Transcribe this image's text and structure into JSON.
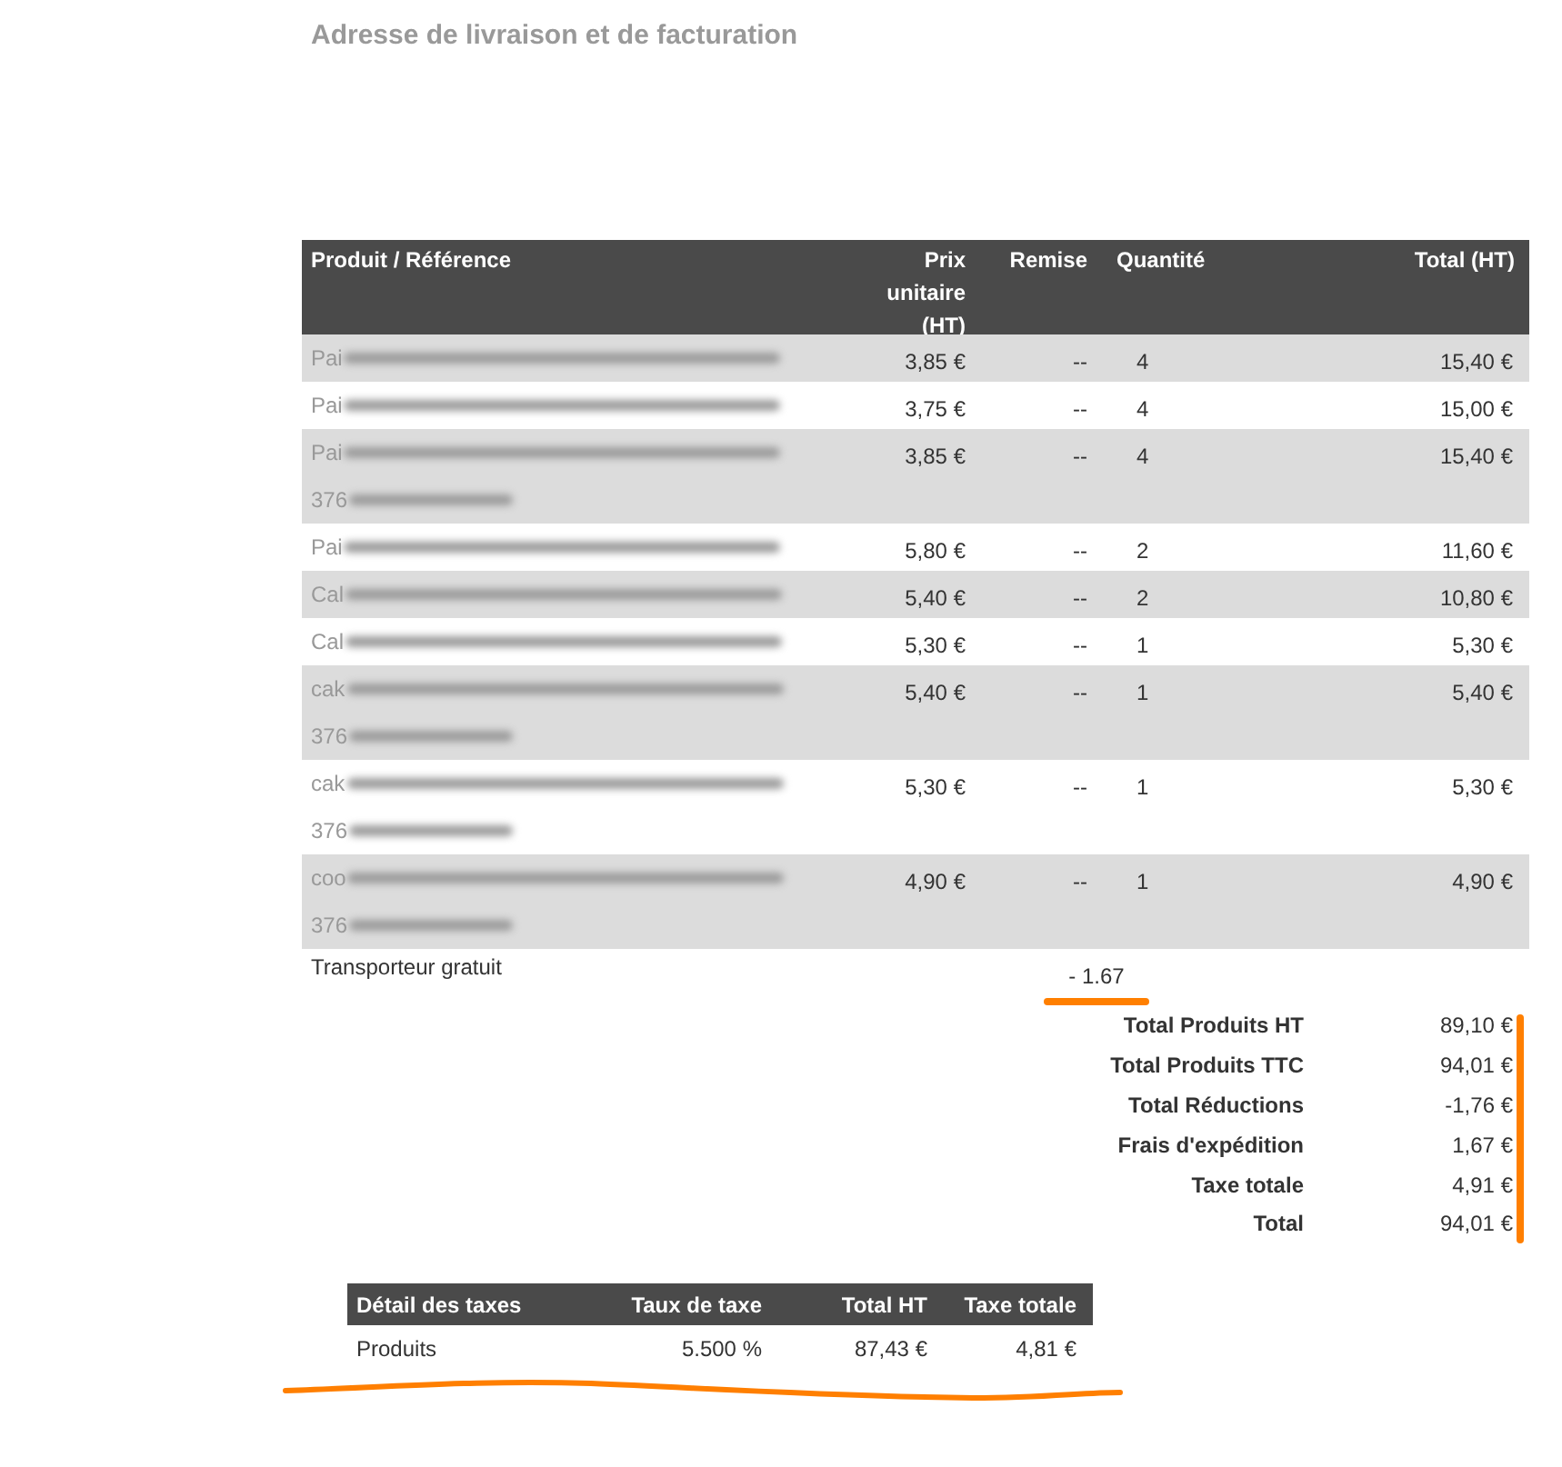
{
  "heading": "Adresse de livraison et de facturation",
  "products": {
    "columns": [
      "Produit / Référence",
      "Prix unitaire (HT)",
      "Remise",
      "Quantité",
      "Total (HT)"
    ],
    "rows": [
      {
        "name": "Pai",
        "price": "3,85 €",
        "discount": "--",
        "quantity": "4",
        "total": "15,40 €"
      },
      {
        "name": "Pai",
        "price": "3,75 €",
        "discount": "--",
        "quantity": "4",
        "total": "15,00 €"
      },
      {
        "name": "Pai",
        "reference": "376",
        "price": "3,85 €",
        "discount": "--",
        "quantity": "4",
        "total": "15,40 €"
      },
      {
        "name": "Pai",
        "price": "5,80 €",
        "discount": "--",
        "quantity": "2",
        "total": "11,60 €"
      },
      {
        "name": "Cal",
        "price": "5,40 €",
        "discount": "--",
        "quantity": "2",
        "total": "10,80 €"
      },
      {
        "name": "Cal",
        "price": "5,30 €",
        "discount": "--",
        "quantity": "1",
        "total": "5,30 €"
      },
      {
        "name": "cak",
        "reference": "376",
        "price": "5,40 €",
        "discount": "--",
        "quantity": "1",
        "total": "5,40 €"
      },
      {
        "name": "cak",
        "reference": "376",
        "price": "5,30 €",
        "discount": "--",
        "quantity": "1",
        "total": "5,30 €"
      },
      {
        "name": "coo",
        "reference": "376",
        "price": "4,90 €",
        "discount": "--",
        "quantity": "1",
        "total": "4,90 €"
      }
    ]
  },
  "carrier": {
    "name": "Transporteur gratuit",
    "amount": "- 1.67"
  },
  "totals": [
    {
      "label": "Total Produits HT",
      "value": "89,10 €"
    },
    {
      "label": "Total Produits TTC",
      "value": "94,01 €"
    },
    {
      "label": "Total Réductions",
      "value": "-1,76 €"
    },
    {
      "label": "Frais d'expédition",
      "value": "1,67 €"
    },
    {
      "label": "Taxe totale",
      "value": "4,91 €"
    },
    {
      "label": "Total",
      "value": "94,01 €"
    }
  ],
  "tax_table": {
    "columns": [
      "Détail des taxes",
      "Taux de taxe",
      "Total HT",
      "Taxe totale"
    ],
    "rows": [
      {
        "label": "Produits",
        "rate": "5.500 %",
        "total_ht": "87,43 €",
        "tax": "4,81 €"
      }
    ]
  }
}
